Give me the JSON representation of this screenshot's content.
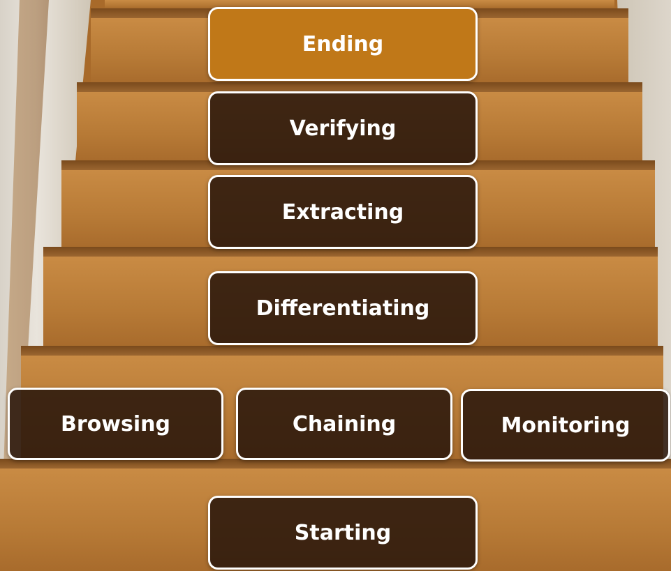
{
  "steps": {
    "ending": "Ending",
    "verifying": "Verifying",
    "extracting": "Extracting",
    "differentiating": "Differentiating",
    "browsing": "Browsing",
    "chaining": "Chaining",
    "monitoring": "Monitoring",
    "starting": "Starting"
  },
  "colors": {
    "active_box": "#c07818",
    "box": "#2b180c",
    "border": "#ffffff"
  }
}
